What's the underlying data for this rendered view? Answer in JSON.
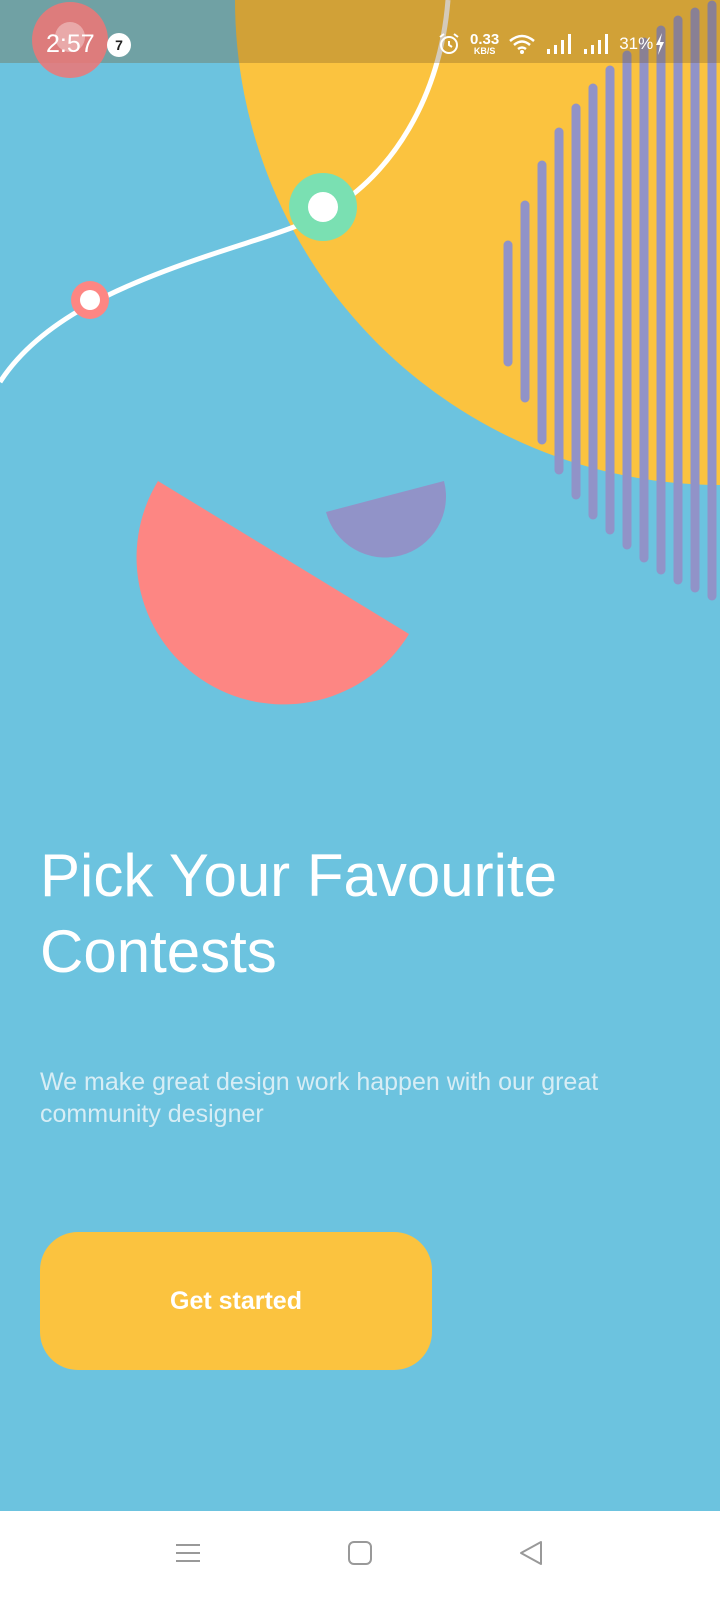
{
  "status_bar": {
    "time": "2:57",
    "notification_count": "7",
    "network_speed": "0.33",
    "network_speed_unit": "KB/S",
    "battery": "31%",
    "icons": [
      "alarm-icon",
      "wifi-icon",
      "signal-icon",
      "signal-icon",
      "charging-icon"
    ]
  },
  "onboarding": {
    "title_line1": "Pick Your Favourite",
    "title_line2": "Contests",
    "subtitle": "We make great design work happen with our great community designer",
    "cta_label": "Get started"
  },
  "navigation_bar": {
    "icons": [
      "menu-icon",
      "home-icon",
      "back-icon"
    ]
  },
  "colors": {
    "background": "#6cc3df",
    "accent_yellow": "#fbc33f",
    "coral": "#fd8683",
    "purple": "#9193c8",
    "mint": "#7ae0b2",
    "text_white": "#ffffff",
    "subtitle_text": "#d7edf5"
  }
}
